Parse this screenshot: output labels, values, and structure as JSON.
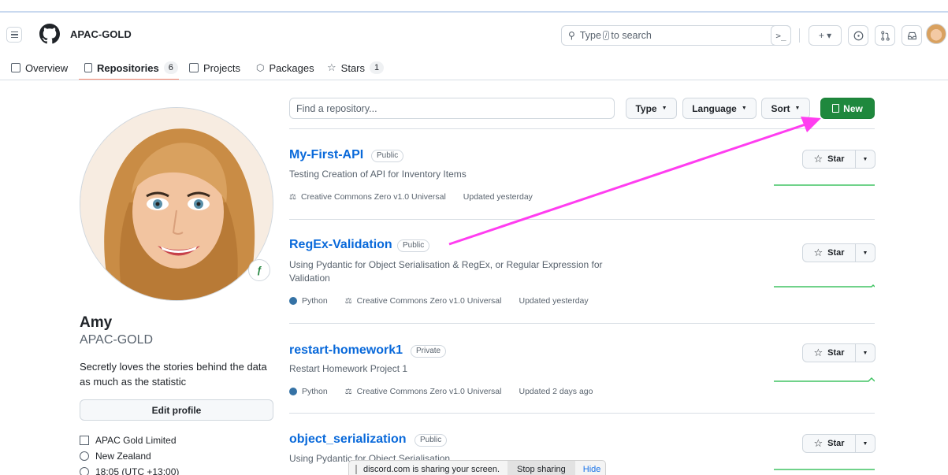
{
  "header": {
    "org_name": "APAC-GOLD",
    "search_placeholder_pre": "Type",
    "search_key": "/",
    "search_placeholder_post": "to search",
    "terminal_glyph": ">_",
    "plus_glyph": "+ ▾"
  },
  "nav": {
    "tabs": [
      {
        "label": "Overview"
      },
      {
        "label": "Repositories",
        "count": "6"
      },
      {
        "label": "Projects"
      },
      {
        "label": "Packages"
      },
      {
        "label": "Stars",
        "count": "1"
      }
    ]
  },
  "profile": {
    "name": "Amy",
    "login": "APAC-GOLD",
    "bio": "Secretly loves the stories behind the data as much as the statistic",
    "edit_label": "Edit profile",
    "company": "APAC Gold Limited",
    "location": "New Zealand",
    "local_time": "18:05 (UTC +13:00)"
  },
  "repo_filters": {
    "find_placeholder": "Find a repository...",
    "type_label": "Type",
    "language_label": "Language",
    "sort_label": "Sort",
    "new_label": "New"
  },
  "repos": [
    {
      "name": "My-First-API",
      "visibility": "Public",
      "description": "Testing Creation of API for Inventory Items",
      "language": "",
      "license": "Creative Commons Zero v1.0 Universal",
      "updated": "Updated yesterday",
      "star_label": "Star"
    },
    {
      "name": "RegEx-Validation",
      "visibility": "Public",
      "description": "Using Pydantic for Object Serialisation & RegEx, or Regular Expression for Validation",
      "language": "Python",
      "license": "Creative Commons Zero v1.0 Universal",
      "updated": "Updated yesterday",
      "star_label": "Star"
    },
    {
      "name": "restart-homework1",
      "visibility": "Private",
      "description": "Restart Homework Project 1",
      "language": "Python",
      "license": "Creative Commons Zero v1.0 Universal",
      "updated": "Updated 2 days ago",
      "star_label": "Star"
    },
    {
      "name": "object_serialization",
      "visibility": "Public",
      "description": "Using Pydantic for Object Serialisation",
      "star_label": "Star"
    }
  ],
  "share_bar": {
    "message": "discord.com is sharing your screen.",
    "stop_label": "Stop sharing",
    "hide_label": "Hide"
  },
  "colors": {
    "accent_green": "#1f883d",
    "link_blue": "#0969da",
    "tab_underline": "#fd8c73",
    "python_dot": "#3572A5",
    "annotation_arrow": "#ff3df0"
  },
  "icons": [
    "hamburger-icon",
    "github-logo-icon",
    "search-icon",
    "terminal-icon",
    "plus-icon",
    "issues-icon",
    "pull-requests-icon",
    "inbox-icon",
    "book-icon",
    "repo-icon",
    "table-icon",
    "package-icon",
    "star-icon",
    "law-icon",
    "building-icon",
    "location-icon",
    "clock-icon"
  ]
}
